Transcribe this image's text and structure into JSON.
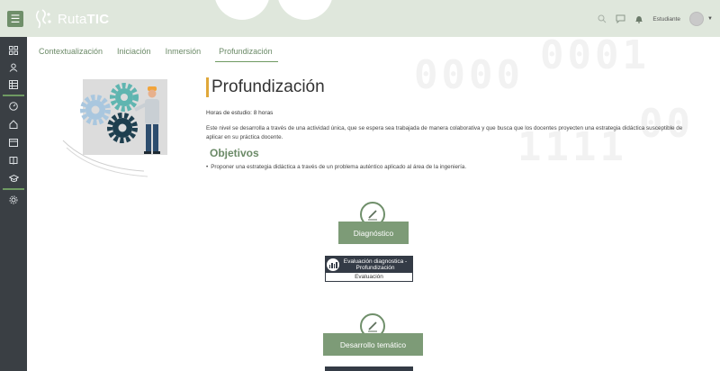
{
  "app": {
    "brand_prefix": "Ruta",
    "brand_suffix": "TIC",
    "user_name": "Estudiante"
  },
  "icons": {
    "menu": "hamburger-icon",
    "search": "search-icon",
    "chat": "chat-icon",
    "notifications": "bell-icon",
    "avatar": "user-avatar",
    "sidebar": [
      "dashboard-icon",
      "users-icon",
      "calendar-grid-icon",
      "gauge-icon",
      "home-icon",
      "calendar-icon",
      "book-icon",
      "graduation-cap-icon",
      "gear-icon"
    ]
  },
  "colors": {
    "accent_green": "#6f9a62",
    "topbar_bg": "#dfe7dc",
    "sidebar_bg": "#3a3f44",
    "section_label_bg": "#7d9b77",
    "title_accent": "#e0a83a"
  },
  "tabs": [
    {
      "label": "Contextualización"
    },
    {
      "label": "Iniciación"
    },
    {
      "label": "Inmersión"
    },
    {
      "label": "Profundización",
      "active": true
    }
  ],
  "main": {
    "title": "Profundización",
    "hours": "Horas de estudio: 8 horas",
    "description": "Este nivel se desarrolla a través de una actividad única, que se espera sea trabajada de manera colaborativa y que busca que los docentes proyecten una estrategia didáctica susceptible de aplicar en su práctica docente.",
    "objectives_title": "Objetivos",
    "objectives": [
      "Proponer una estrategia didáctica a través de un problema auténtico aplicado al área de la ingeniería."
    ]
  },
  "sections": [
    {
      "label": "Diagnóstico",
      "activity": {
        "title": "Evaluación diagnostica - Profundización",
        "type": "Evaluación"
      }
    },
    {
      "label": "Desarrollo temático"
    }
  ]
}
